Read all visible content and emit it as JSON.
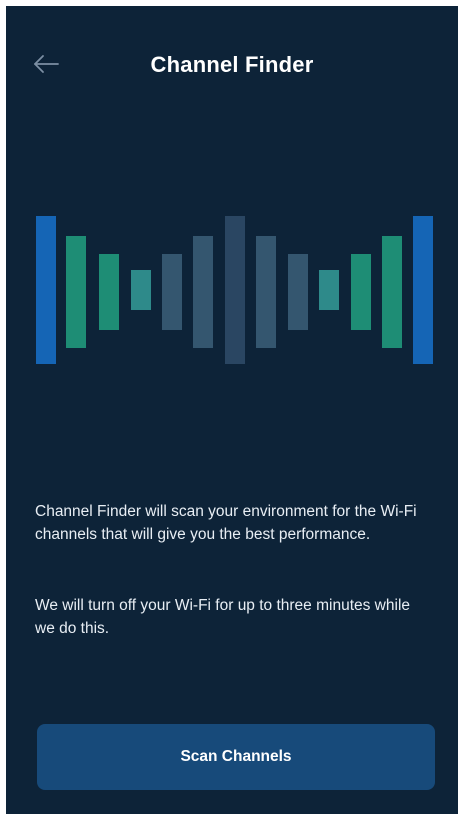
{
  "header": {
    "back_icon": "arrow-left-icon",
    "title": "Channel Finder"
  },
  "graphic": {
    "icon": "channel-bars-illustration",
    "colors": {
      "blue": "#1565b5",
      "teal": "#1e8d75",
      "slate": "#34566f",
      "dark_slate": "#2a4662"
    }
  },
  "main": {
    "description": "Channel Finder will scan your environment for the Wi-Fi channels that will give you the best performance.",
    "note": "We will turn off your Wi-Fi for up to three minutes while we do this."
  },
  "actions": {
    "scan_label": "Scan Channels"
  },
  "colors": {
    "background": "#0d2338",
    "button": "#174a7a",
    "text": "#ffffff"
  }
}
